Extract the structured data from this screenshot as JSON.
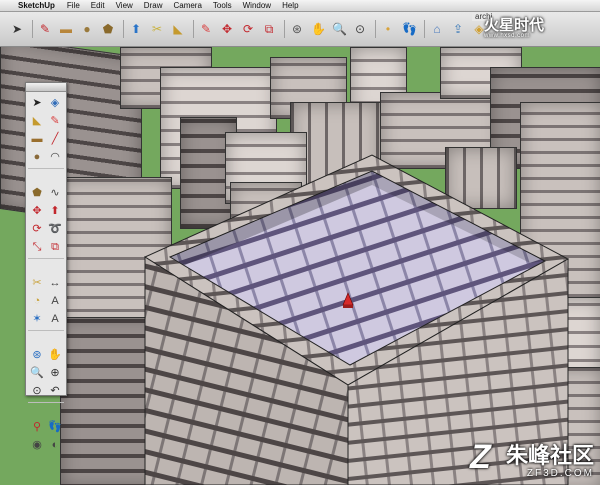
{
  "menubar": {
    "apple_glyph": "",
    "app_name": "SketchUp",
    "items": [
      "File",
      "Edit",
      "View",
      "Draw",
      "Camera",
      "Tools",
      "Window",
      "Help"
    ]
  },
  "toolbar": {
    "doc_title": "archi",
    "tools": [
      {
        "name": "select-icon",
        "color": "#333333"
      },
      {
        "name": "pencil-icon",
        "color": "#c2272d"
      },
      {
        "name": "rectangle-icon",
        "color": "#b8863b"
      },
      {
        "name": "circle-icon",
        "color": "#9a7a3c"
      },
      {
        "name": "polygon-icon",
        "color": "#8a6a2c"
      },
      {
        "name": "push-pull-icon",
        "color": "#2a74c8"
      },
      {
        "name": "tape-icon",
        "color": "#c9b23a"
      },
      {
        "name": "paint-bucket-icon",
        "color": "#c59a2e"
      },
      {
        "name": "eraser-icon",
        "color": "#d84040"
      },
      {
        "name": "move-icon",
        "color": "#c2272d"
      },
      {
        "name": "rotate-icon",
        "color": "#c2272d"
      },
      {
        "name": "offset-icon",
        "color": "#c2272d"
      },
      {
        "name": "orbit-icon",
        "color": "#555555"
      },
      {
        "name": "pan-icon",
        "color": "#666666"
      },
      {
        "name": "zoom-icon",
        "color": "#444444"
      },
      {
        "name": "zoom-extents-icon",
        "color": "#444444"
      },
      {
        "name": "section-icon",
        "color": "#d8a23a"
      },
      {
        "name": "walk-icon",
        "color": "#333333"
      },
      {
        "name": "warehouse-icon",
        "color": "#4a7bbf"
      },
      {
        "name": "share-icon",
        "color": "#3c7ab8"
      },
      {
        "name": "component-icon",
        "color": "#d1a030"
      }
    ]
  },
  "brand": {
    "title": "火星时代",
    "subtitle": "www.hxsd.com"
  },
  "palette": {
    "rows": [
      [
        "select-icon",
        "component-icon"
      ],
      [
        "paint-bucket-icon",
        "eraser-icon"
      ],
      [
        "rectangle-icon",
        "line-icon"
      ],
      [
        "circle-icon",
        "arc-icon"
      ],
      [
        "polygon-icon",
        "freehand-icon"
      ],
      [
        "move-icon",
        "push-pull-icon"
      ],
      [
        "rotate-icon",
        "follow-me-icon"
      ],
      [
        "scale-icon",
        "offset-icon"
      ],
      [
        "tape-icon",
        "dimension-icon"
      ],
      [
        "protractor-icon",
        "text-icon"
      ],
      [
        "axes-icon",
        "3d-text-icon"
      ],
      [
        "orbit-icon",
        "pan-icon"
      ],
      [
        "zoom-icon",
        "zoom-window-icon"
      ],
      [
        "zoom-extents-icon",
        "previous-icon"
      ],
      [
        "position-camera-icon",
        "walk-icon"
      ],
      [
        "look-around-icon",
        "section-plane-icon"
      ]
    ]
  },
  "watermark": {
    "logo": "Z",
    "cn": "朱峰社区",
    "en": "ZF3D.COM"
  }
}
